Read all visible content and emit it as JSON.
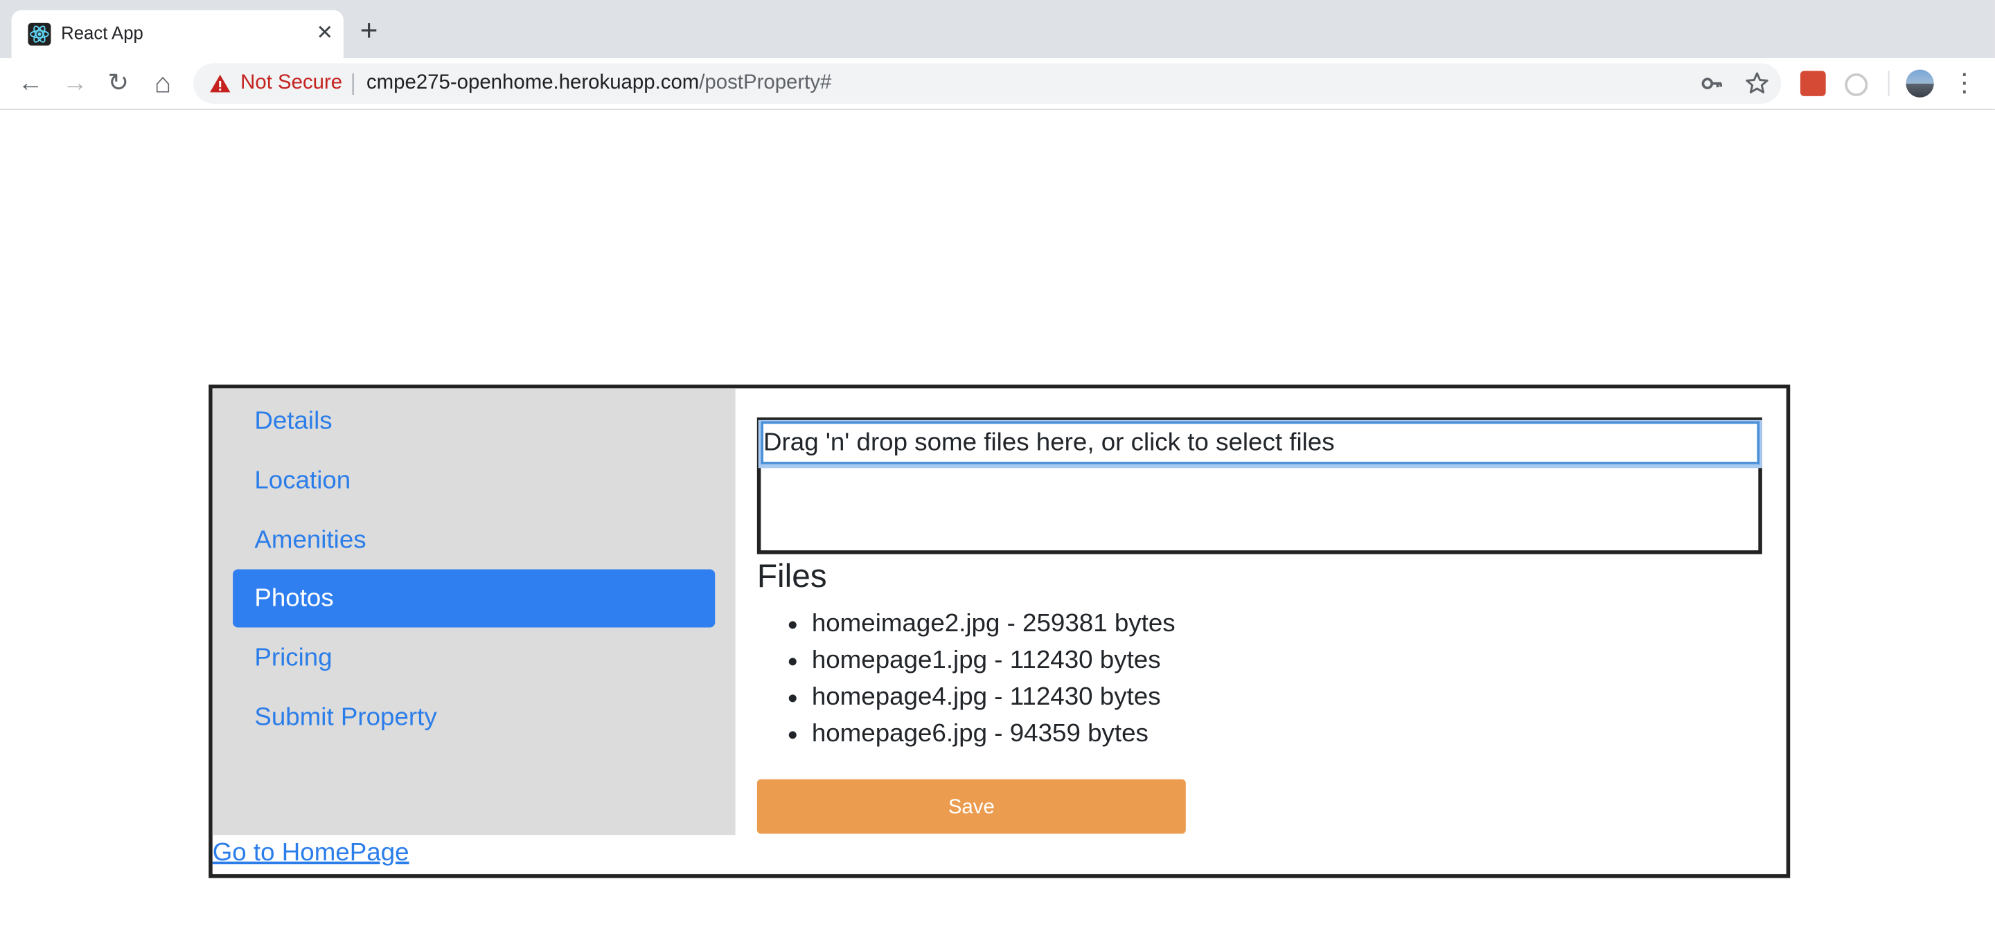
{
  "browser": {
    "tab_title": "React App",
    "tab_close": "✕",
    "new_tab": "+",
    "security_label": "Not Secure",
    "url_host": "cmpe275-openhome.herokuapp.com",
    "url_path": "/postProperty#",
    "nav": {
      "back": "←",
      "forward": "→",
      "reload": "↻",
      "home": "⌂"
    },
    "icons": {
      "key": "key-icon",
      "star": "star-icon",
      "menu": "more-vert-icon"
    }
  },
  "sidebar": {
    "items": [
      {
        "label": "Details"
      },
      {
        "label": "Location"
      },
      {
        "label": "Amenities"
      },
      {
        "label": "Photos"
      },
      {
        "label": "Pricing"
      },
      {
        "label": "Submit Property"
      }
    ],
    "active_label": "Photos"
  },
  "dropzone": {
    "text": "Drag 'n' drop some files here, or click to select files"
  },
  "files": {
    "heading": "Files",
    "items": [
      "homeimage2.jpg - 259381 bytes",
      "homepage1.jpg - 112430 bytes",
      "homepage4.jpg - 112430 bytes",
      "homepage6.jpg - 94359 bytes"
    ]
  },
  "actions": {
    "save_label": "Save"
  },
  "footer": {
    "home_link": "Go to HomePage"
  },
  "colors": {
    "link": "#2b7de9",
    "active_nav": "#2f7ff0",
    "save_button": "#eb9c4f",
    "sidebar_bg": "#dcdcdc",
    "not_secure": "#c5221f"
  }
}
